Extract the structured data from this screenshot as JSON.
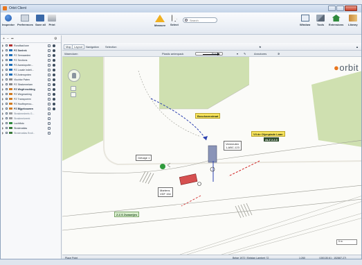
{
  "window": {
    "title": "Orbit Client"
  },
  "ribbon": {
    "left_buttons": [
      {
        "label": "Inspector",
        "icon": "info-icon"
      },
      {
        "label": "Preferences",
        "icon": "preferences-icon"
      },
      {
        "label": "Save all",
        "icon": "save-icon"
      },
      {
        "label": "Print",
        "icon": "print-icon"
      }
    ],
    "measure": {
      "label": "Measure",
      "icon": "measure-icon"
    },
    "select": {
      "label": "Select",
      "icon": "select-cursor-icon"
    },
    "search": {
      "placeholder": "Search"
    },
    "right_buttons": [
      {
        "label": "Window",
        "icon": "window-icon"
      },
      {
        "label": "Tools",
        "icon": "tools-icon"
      },
      {
        "label": "Extensions",
        "icon": "extensions-icon"
      },
      {
        "label": "Library",
        "icon": "library-icon"
      }
    ]
  },
  "layers": [
    {
      "label": "Rondfaal kwe",
      "color": "#b23030"
    },
    {
      "label": "PZ Snelrek",
      "color": "#1f6fb8",
      "bold": true
    },
    {
      "label": "PZ Semaarden",
      "color": "#1f6fb8"
    },
    {
      "label": "PZ Sections",
      "color": "#1f6fb8"
    },
    {
      "label": "PZ Aanstopofer...",
      "color": "#1f6fb8"
    },
    {
      "label": "PZ Locale indeli...",
      "color": "#1f6fb8"
    },
    {
      "label": "PZ Anteropnten",
      "color": "#1f6fb8"
    },
    {
      "label": "Vluchtw Paten",
      "color": "#8a8a8a"
    },
    {
      "label": "PZ Strakenrelam",
      "color": "#8a8a8a"
    },
    {
      "label": "PZ Wegfrenchting",
      "color": "#d07a20",
      "bold": true
    },
    {
      "label": "PZ Wegmarking",
      "color": "#d07a20"
    },
    {
      "label": "PZ Transporem",
      "color": "#d07a20"
    },
    {
      "label": "PZ Hooftnperou...",
      "color": "#d07a20"
    },
    {
      "label": "PZ Bijgebouwen",
      "color": "#d07a20",
      "bold": true
    },
    {
      "label": "Strakimedeels G...",
      "color": "#9a9a9a",
      "muted": true
    },
    {
      "label": "Strakimelweek",
      "color": "#9a9a9a",
      "muted": true
    },
    {
      "label": "Luchtfoto",
      "color": "#2f8a3c"
    },
    {
      "label": "Stratenatlas",
      "color": "#3a7a3a"
    },
    {
      "label": "Stratenatlas Bruil...",
      "color": "#3a7a3a",
      "muted": true
    }
  ],
  "map_toolbar": {
    "tabs": [
      "Map",
      "Layout"
    ],
    "menus": [
      "Navigation",
      "Selection"
    ]
  },
  "sub_toolbar": {
    "left_label": "Warmdoen",
    "brush_label": "Plastic antenpack",
    "mode": "Bradt",
    "annotate": "Annotores"
  },
  "map_labels": {
    "street_1": "Boscharmstraat",
    "street_2": "Vil de Olympiade Laan",
    "street_2_sub": "ALZ 2.2.3",
    "street_3": "Z.Z.S Zwaantjes",
    "callout_person": "Getuige 1",
    "callout_van_title": "Vermeulen",
    "callout_van_plate": "1-ABC-123",
    "callout_car_title": "Martens",
    "callout_car_plate": "VDF 154",
    "logo_main": "orbit"
  },
  "statusbar": {
    "left": "Place Point",
    "crs": "Belge 1972 / Belgian Lambert 72",
    "scale": "1:260",
    "coords": "(150130,61 ; 152887,27)"
  },
  "scale_label": "5 m"
}
